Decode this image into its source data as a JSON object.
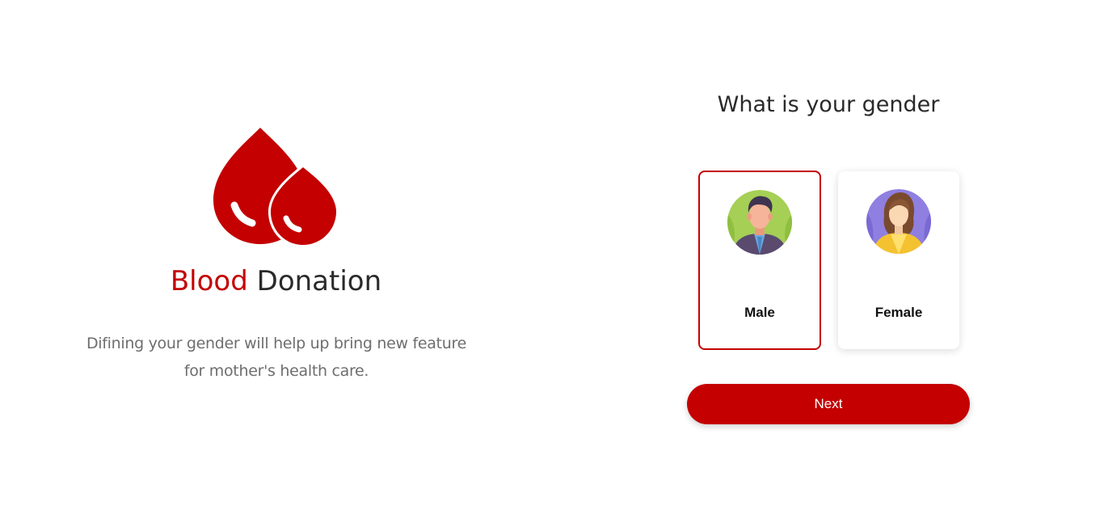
{
  "brand": {
    "word1": "Blood",
    "word2": "Donation",
    "accent_color": "#c40000",
    "logo_icon": "blood-drops-icon"
  },
  "tagline": "Difining your gender will help up bring new feature for mother's health care.",
  "question": "What is your gender",
  "options": [
    {
      "label": "Male",
      "icon": "male-avatar-icon",
      "selected": true
    },
    {
      "label": "Female",
      "icon": "female-avatar-icon",
      "selected": false
    }
  ],
  "next_label": "Next"
}
